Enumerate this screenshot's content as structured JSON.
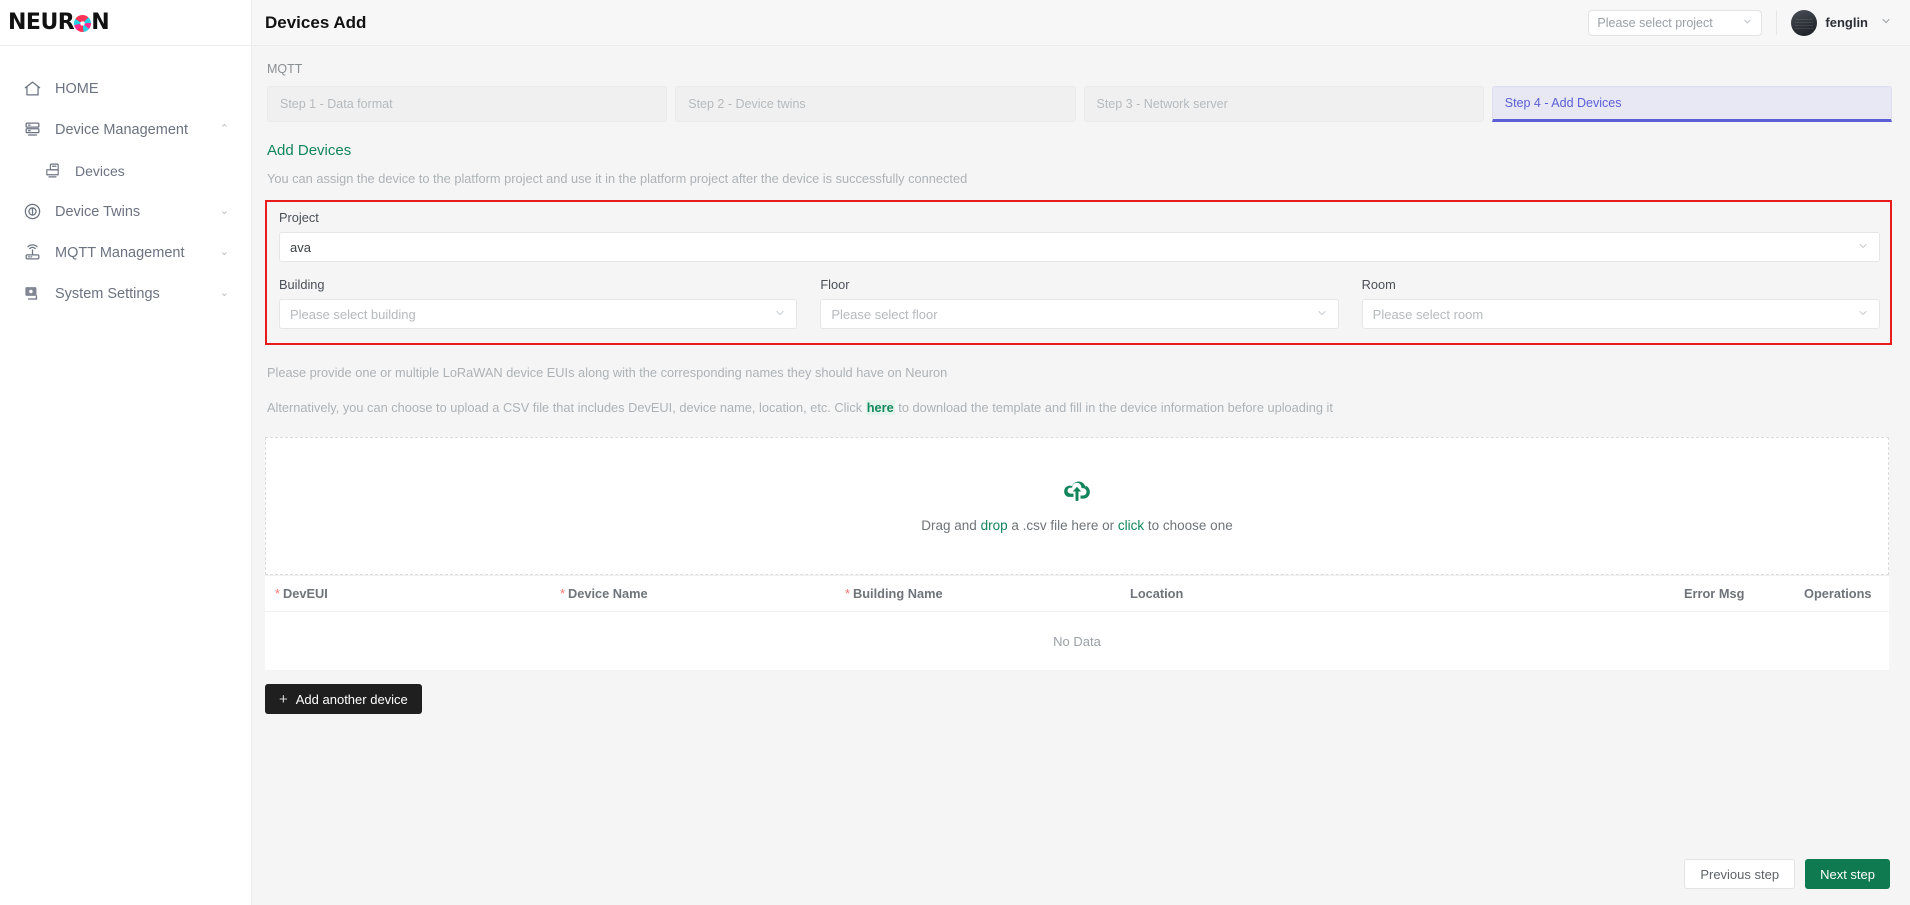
{
  "brand": {
    "name": "NEURON",
    "logo_icon": "neuron-burst-icon"
  },
  "sidebar": {
    "items": [
      {
        "label": "HOME",
        "icon": "home-icon",
        "chevron": "",
        "sub": false
      },
      {
        "label": "Device Management",
        "icon": "server-rack-icon",
        "chevron": "⌃",
        "sub": false
      },
      {
        "label": "Devices",
        "icon": "device-icon",
        "chevron": "",
        "sub": true
      },
      {
        "label": "Device Twins",
        "icon": "twins-circle-icon",
        "chevron": "⌄",
        "sub": false
      },
      {
        "label": "MQTT Management",
        "icon": "router-signal-icon",
        "chevron": "⌄",
        "sub": false
      },
      {
        "label": "System Settings",
        "icon": "monitor-gear-icon",
        "chevron": "⌄",
        "sub": false
      }
    ]
  },
  "topbar": {
    "title": "Devices Add",
    "project_select_placeholder": "Please select project",
    "user_name": "fenglin",
    "chevron_down": "⌄"
  },
  "breadcrumb": "MQTT",
  "steps": [
    {
      "label": "Step 1 - Data format",
      "active": false
    },
    {
      "label": "Step 2 - Device twins",
      "active": false
    },
    {
      "label": "Step 3 - Network server",
      "active": false
    },
    {
      "label": "Step 4 - Add Devices",
      "active": true
    }
  ],
  "section": {
    "title": "Add Devices",
    "description": "You can assign the device to the platform project and use it in the platform project after the device is successfully connected"
  },
  "form": {
    "project": {
      "label": "Project",
      "value": "ava"
    },
    "building": {
      "label": "Building",
      "placeholder": "Please select building"
    },
    "floor": {
      "label": "Floor",
      "placeholder": "Please select floor"
    },
    "room": {
      "label": "Room",
      "placeholder": "Please select room"
    }
  },
  "hints": {
    "eui": "Please provide one or multiple LoRaWAN device EUIs along with the corresponding names they should have on Neuron",
    "csv_before": "Alternatively, you can choose to upload a CSV file that includes DevEUI, device name, location, etc. Click",
    "csv_link": "here",
    "csv_after": "to download the template and fill in the device information before uploading it"
  },
  "dropzone": {
    "icon": "cloud-upload-icon",
    "text_1": "Drag and ",
    "text_drop": "drop",
    "text_2": " a .csv file here or ",
    "text_click": "click",
    "text_3": " to choose one"
  },
  "table": {
    "required_mark": "*",
    "columns": [
      {
        "label": "DevEUI",
        "required": true
      },
      {
        "label": "Device Name",
        "required": true
      },
      {
        "label": "Building Name",
        "required": true
      },
      {
        "label": "Location",
        "required": false
      },
      {
        "label": "Error Msg",
        "required": false
      },
      {
        "label": "Operations",
        "required": false
      }
    ],
    "empty_text": "No Data"
  },
  "buttons": {
    "add_another": "Add another device",
    "add_another_icon": "plus-icon",
    "previous": "Previous step",
    "next": "Next step"
  },
  "colors": {
    "accent_green": "#0f7a50",
    "link_green": "#138a5e",
    "active_step_purple": "#5b5fd6",
    "highlight_red": "#e81c1c",
    "required_red": "#f0736e"
  }
}
